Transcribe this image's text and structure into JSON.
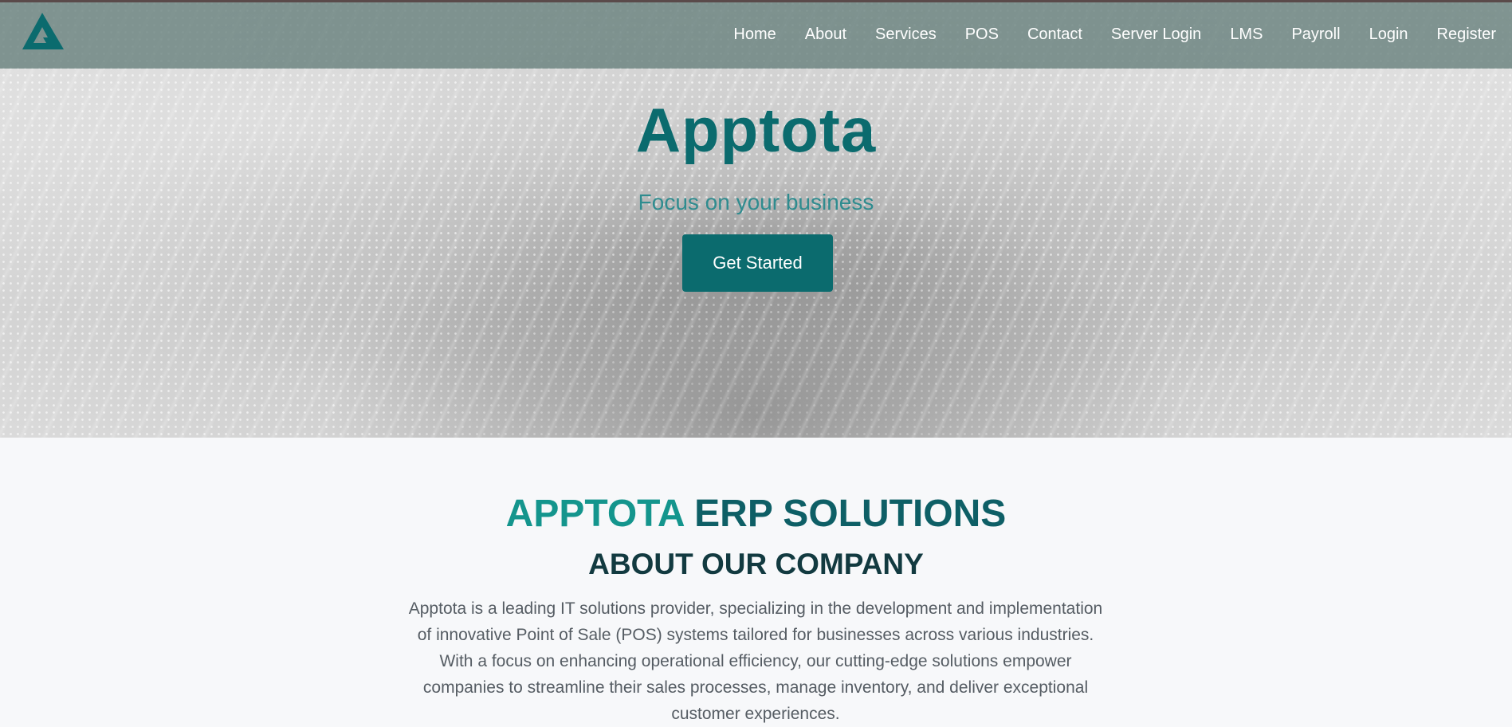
{
  "brand": {
    "logo_icon": "apptota-a-logo-icon",
    "primary_color": "#0b6b6e",
    "accent_color": "#14958d"
  },
  "nav": {
    "items": [
      {
        "label": "Home"
      },
      {
        "label": "About"
      },
      {
        "label": "Services"
      },
      {
        "label": "POS"
      },
      {
        "label": "Contact"
      },
      {
        "label": "Server Login"
      },
      {
        "label": "LMS"
      },
      {
        "label": "Payroll"
      },
      {
        "label": "Login"
      },
      {
        "label": "Register"
      }
    ]
  },
  "hero": {
    "title": "Apptota",
    "subtitle": "Focus on your business",
    "cta_label": "Get Started"
  },
  "about": {
    "heading_accent": "APPTOTA",
    "heading_rest": "ERP SOLUTIONS",
    "subheading": "ABOUT OUR COMPANY",
    "body": "Apptota is a leading IT solutions provider, specializing in the development and implementation of innovative Point of Sale (POS) systems tailored for businesses across various industries. With a focus on enhancing operational efficiency, our cutting-edge solutions empower companies to streamline their sales processes, manage inventory, and deliver exceptional customer experiences."
  }
}
